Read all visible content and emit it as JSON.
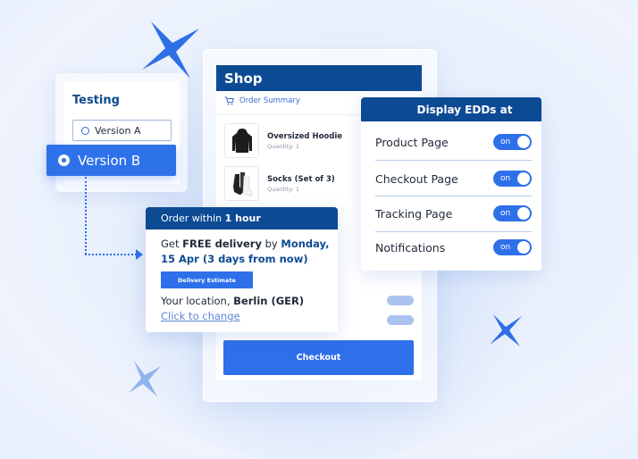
{
  "testing": {
    "title": "Testing",
    "options": [
      {
        "label": "Version A",
        "selected": false
      },
      {
        "label": "Version B",
        "selected": true
      }
    ]
  },
  "shop": {
    "title": "Shop",
    "order_summary_label": "Order Summary",
    "products": [
      {
        "name": "Oversized Hoodie",
        "quantity": "Quantity: 1",
        "icon": "hoodie-icon"
      },
      {
        "name": "Socks (Set of 3)",
        "quantity": "Quantity: 1",
        "icon": "socks-icon"
      }
    ],
    "checkout_label": "Checkout"
  },
  "edd_panel": {
    "title": "Display EDDs at",
    "rows": [
      {
        "label": "Product Page",
        "toggle": "on"
      },
      {
        "label": "Checkout Page",
        "toggle": "on"
      },
      {
        "label": "Tracking Page",
        "toggle": "on"
      },
      {
        "label": "Notifications",
        "toggle": "on"
      }
    ]
  },
  "delivery": {
    "header_prefix": "Order within ",
    "header_bold": "1 hour",
    "get": "Get ",
    "free": "FREE delivery",
    "by": " by ",
    "date_line1": "Monday,",
    "date_line2": "15 Apr (3 days from now)",
    "button_label": "Delivery Estimate",
    "location_prefix": "Your location, ",
    "location_city": "Berlin (GER)",
    "change_link": "Click to change"
  },
  "colors": {
    "brand_dark": "#0d4a94",
    "accent": "#2e6fea"
  }
}
